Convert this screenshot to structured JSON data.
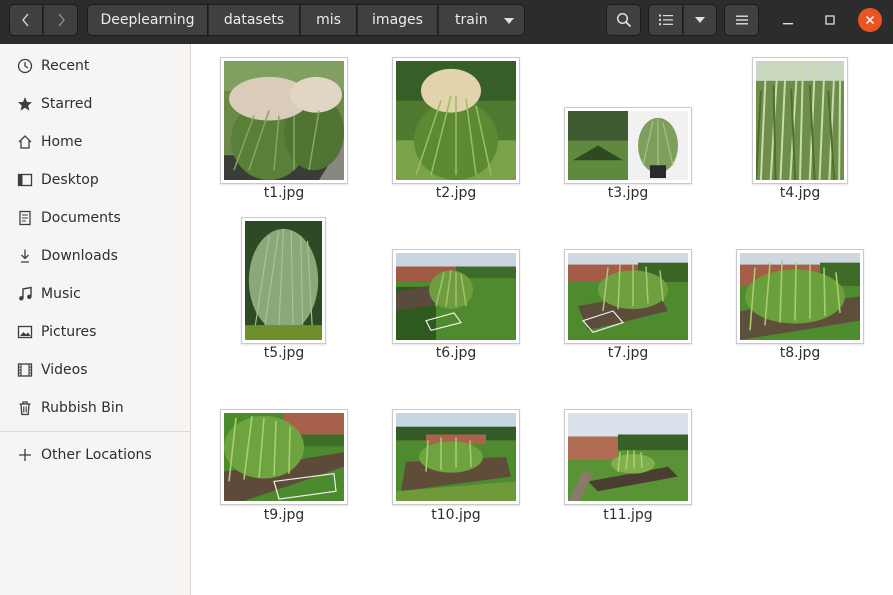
{
  "header": {
    "breadcrumbs": [
      "Deeplearning",
      "datasets",
      "mis",
      "images",
      "train"
    ],
    "icons": {
      "back": "chevron-left-icon",
      "forward": "chevron-right-icon",
      "search": "search-icon",
      "view": "list-view-icon",
      "view_dropdown": "chevron-down-icon",
      "menu": "hamburger-menu-icon",
      "minimize": "minimize-icon",
      "maximize": "maximize-icon",
      "close": "close-icon"
    },
    "close_color": "#e95420"
  },
  "sidebar": {
    "items": [
      {
        "label": "Recent",
        "icon": "clock-icon"
      },
      {
        "label": "Starred",
        "icon": "star-icon"
      },
      {
        "label": "Home",
        "icon": "home-icon"
      },
      {
        "label": "Desktop",
        "icon": "desktop-icon"
      },
      {
        "label": "Documents",
        "icon": "document-icon"
      },
      {
        "label": "Downloads",
        "icon": "download-icon"
      },
      {
        "label": "Music",
        "icon": "music-icon"
      },
      {
        "label": "Pictures",
        "icon": "picture-icon"
      },
      {
        "label": "Videos",
        "icon": "video-icon"
      },
      {
        "label": "Rubbish Bin",
        "icon": "trash-icon"
      }
    ],
    "other_locations": {
      "label": "Other Locations",
      "icon": "plus-icon"
    }
  },
  "files": [
    {
      "name": "t1.jpg"
    },
    {
      "name": "t2.jpg"
    },
    {
      "name": "t3.jpg"
    },
    {
      "name": "t4.jpg"
    },
    {
      "name": "t5.jpg"
    },
    {
      "name": "t6.jpg"
    },
    {
      "name": "t7.jpg"
    },
    {
      "name": "t8.jpg"
    },
    {
      "name": "t9.jpg"
    },
    {
      "name": "t10.jpg"
    },
    {
      "name": "t11.jpg"
    }
  ]
}
